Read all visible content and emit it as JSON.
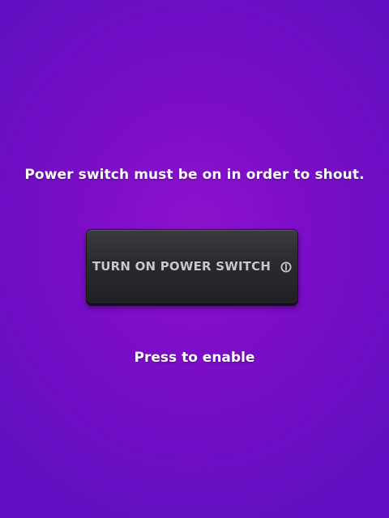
{
  "notice": {
    "message": "Power switch must be on in order to shout."
  },
  "power_button": {
    "label": "TURN ON POWER SWITCH",
    "icon": "power-icon"
  },
  "hint": {
    "text": "Press to enable"
  },
  "colors": {
    "background": "#7a0dc8",
    "button": "#2a2b30",
    "button_text": "#c8c8cc",
    "text": "#ffffff"
  }
}
